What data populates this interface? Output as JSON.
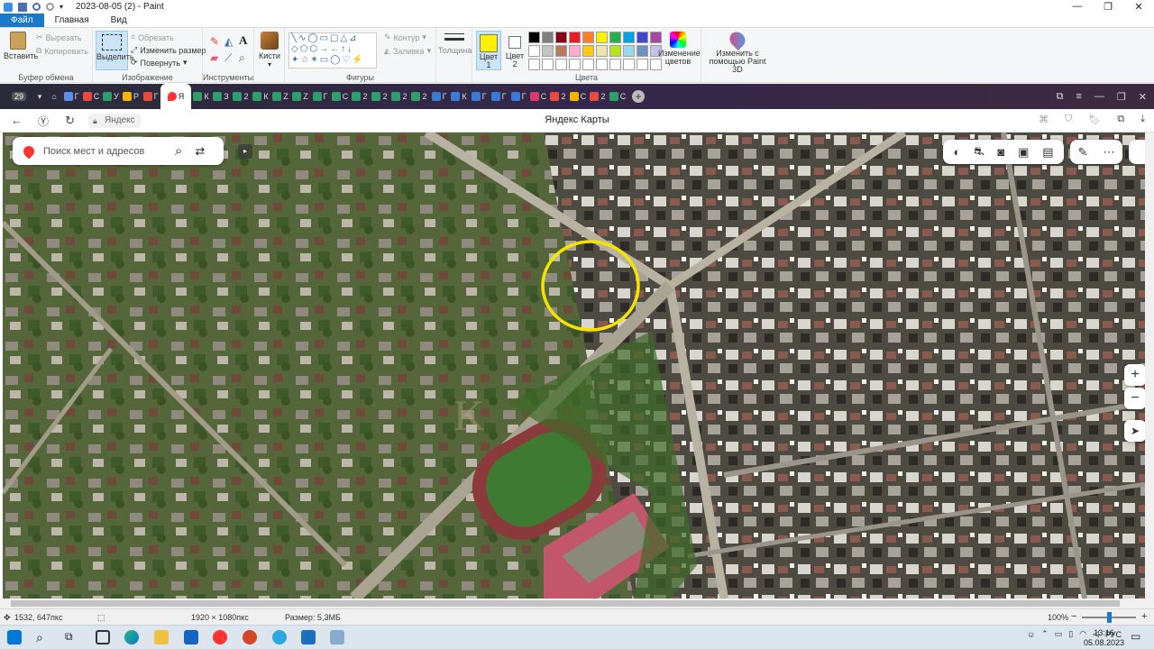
{
  "window": {
    "title": "2023-08-05 (2) - Paint"
  },
  "menu": {
    "tabs": [
      "Файл",
      "Главная",
      "Вид"
    ]
  },
  "ribbon": {
    "clipboard": {
      "label": "Буфер обмена",
      "paste": "Вставить",
      "cut": "Вырезать",
      "copy": "Копировать"
    },
    "image": {
      "label": "Изображение",
      "select": "Выделить",
      "crop": "Обрезать",
      "resize": "Изменить размер",
      "rotate": "Повернуть"
    },
    "tools": {
      "label": "Инструменты"
    },
    "brushes": {
      "label": "Кисти"
    },
    "shapes": {
      "label": "Фигуры",
      "outline": "Контур",
      "fill": "Заливка"
    },
    "size": {
      "label": "Толщина"
    },
    "colors": {
      "label": "Цвета",
      "color1": "Цвет 1",
      "color2": "Цвет 2",
      "edit": "Изменение цветов",
      "color1_value": "#ffef00",
      "color2_value": "#ffffff",
      "palette_row1": [
        "#000000",
        "#7f7f7f",
        "#880015",
        "#ed1c24",
        "#ff7f27",
        "#fff200",
        "#22b14c",
        "#00a2e8",
        "#3f48cc",
        "#a349a4"
      ],
      "palette_row2": [
        "#ffffff",
        "#c3c3c3",
        "#b97a57",
        "#ffaec9",
        "#ffc90e",
        "#efe4b0",
        "#b5e61d",
        "#99d9ea",
        "#7092be",
        "#c8bfe7"
      ]
    },
    "paint3d": "Изменить с помощью Paint 3D"
  },
  "browser": {
    "tab_count": "29",
    "tabs": [
      {
        "letter": "Г",
        "color": "#5b8def"
      },
      {
        "letter": "С",
        "color": "#e84a3c"
      },
      {
        "letter": "У",
        "color": "#2e9f6a"
      },
      {
        "letter": "Р",
        "color": "#f4b400"
      },
      {
        "letter": "Г",
        "color": "#e84a3c"
      },
      {
        "letter": "Я",
        "color": "#ff3333",
        "active": true
      },
      {
        "letter": "К",
        "color": "#2e9f6a"
      },
      {
        "letter": "З",
        "color": "#2e9f6a"
      },
      {
        "letter": "2",
        "color": "#2e9f6a"
      },
      {
        "letter": "К",
        "color": "#2e9f6a"
      },
      {
        "letter": "Z",
        "color": "#2e9f6a"
      },
      {
        "letter": "Z",
        "color": "#2e9f6a"
      },
      {
        "letter": "Г",
        "color": "#2e9f6a"
      },
      {
        "letter": "С",
        "color": "#2e9f6a"
      },
      {
        "letter": "2",
        "color": "#2e9f6a"
      },
      {
        "letter": "2",
        "color": "#2e9f6a"
      },
      {
        "letter": "2",
        "color": "#2e9f6a"
      },
      {
        "letter": "2",
        "color": "#2e9f6a"
      },
      {
        "letter": "Г",
        "color": "#3a7bd5"
      },
      {
        "letter": "К",
        "color": "#3a7bd5"
      },
      {
        "letter": "Г",
        "color": "#3a7bd5"
      },
      {
        "letter": "Г",
        "color": "#3a7bd5"
      },
      {
        "letter": "Г",
        "color": "#3a7bd5"
      },
      {
        "letter": "С",
        "color": "#d63a6c"
      },
      {
        "letter": "2",
        "color": "#e84a3c"
      },
      {
        "letter": "С",
        "color": "#f4b400"
      },
      {
        "letter": "2",
        "color": "#e84a3c"
      },
      {
        "letter": "С",
        "color": "#2e9f6a"
      }
    ],
    "url_text": "Яндекс",
    "page_title": "Яндекс Карты"
  },
  "map": {
    "search_placeholder": "Поиск мест и адресов",
    "zoom_in": "+",
    "zoom_out": "−"
  },
  "status": {
    "cursor": "1532, 647пкс",
    "dimensions": "1920 × 1080пкс",
    "size": "Размер: 5,3МБ",
    "zoom": "100%"
  },
  "taskbar": {
    "lang": "РУС",
    "time": "13:16",
    "date": "05.08.2023"
  }
}
